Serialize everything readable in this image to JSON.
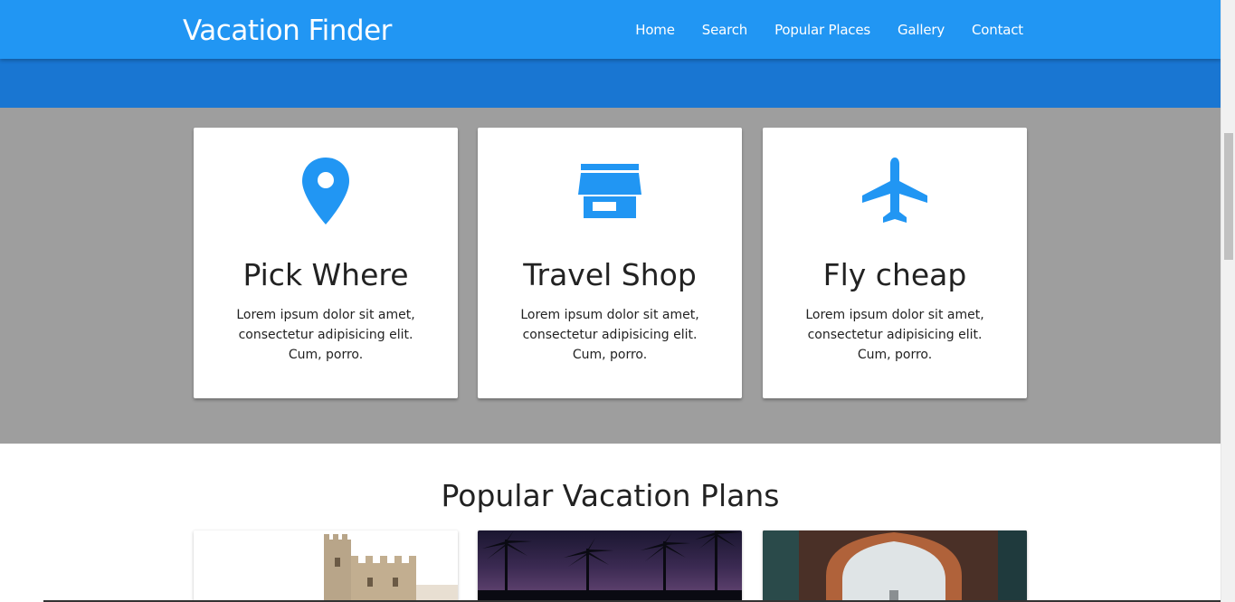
{
  "navbar": {
    "brand": "Vacation Finder",
    "links": [
      "Home",
      "Search",
      "Popular Places",
      "Gallery",
      "Contact"
    ]
  },
  "features": [
    {
      "icon": "map-marker-icon",
      "title": "Pick Where",
      "text": "Lorem ipsum dolor sit amet, consectetur adipisicing elit. Cum, porro."
    },
    {
      "icon": "store-icon",
      "title": "Travel Shop",
      "text": "Lorem ipsum dolor sit amet, consectetur adipisicing elit. Cum, porro."
    },
    {
      "icon": "airplane-icon",
      "title": "Fly cheap",
      "text": "Lorem ipsum dolor sit amet, consectetur adipisicing elit. Cum, porro."
    }
  ],
  "popular": {
    "title": "Popular Vacation Plans",
    "photos": [
      "castle-photo",
      "palm-trees-sunset-photo",
      "arch-gateway-photo"
    ]
  },
  "colors": {
    "nav": "#2196f3",
    "band": "#1976d2",
    "gray": "#9e9e9e",
    "icon": "#2196f3"
  }
}
